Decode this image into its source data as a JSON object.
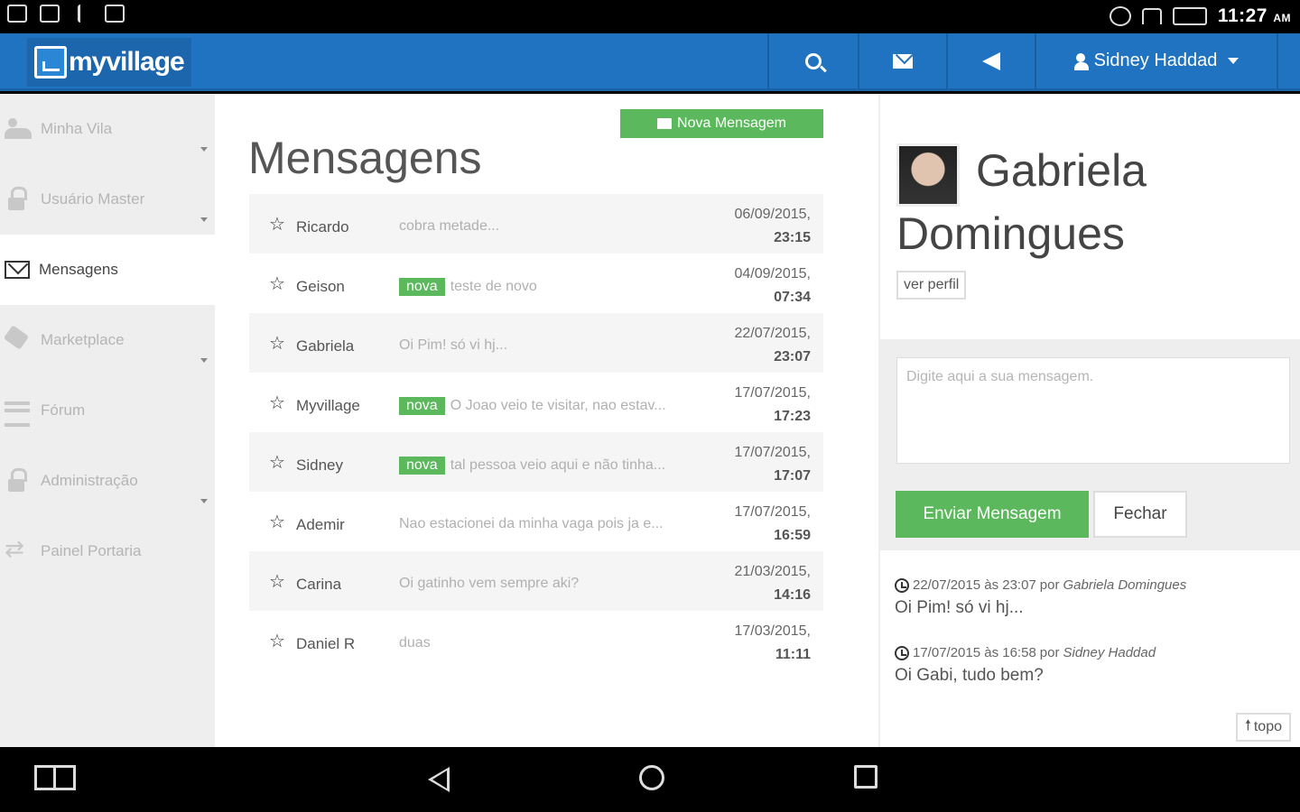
{
  "status_bar": {
    "time": "11:27",
    "ampm": "AM",
    "icons": [
      "gallery-icon",
      "image-icon",
      "usb-icon",
      "briefcase-icon",
      "at-icon",
      "wifi-icon",
      "battery-icon"
    ]
  },
  "header": {
    "logo_text": "myvillage",
    "user_name": "Sidney Haddad",
    "icons": [
      "search-icon",
      "envelope-icon",
      "megaphone-icon",
      "user-icon"
    ],
    "color": "#1f73c1"
  },
  "sidebar": {
    "items": [
      {
        "label": "Minha Vila",
        "icon": "users-icon",
        "active": false,
        "has_submenu": true
      },
      {
        "label": "Usuário Master",
        "icon": "lock-icon",
        "active": false,
        "has_submenu": true
      },
      {
        "label": "Mensagens",
        "icon": "envelope-icon",
        "active": true,
        "has_submenu": false
      },
      {
        "label": "Marketplace",
        "icon": "tag-icon",
        "active": false,
        "has_submenu": true
      },
      {
        "label": "Fórum",
        "icon": "forum-icon",
        "active": false,
        "has_submenu": false
      },
      {
        "label": "Administração",
        "icon": "lock-icon",
        "active": false,
        "has_submenu": true
      },
      {
        "label": "Painel Portaria",
        "icon": "swap-icon",
        "active": false,
        "has_submenu": false
      }
    ]
  },
  "messages": {
    "title": "Mensagens",
    "new_button": "Nova Mensagem",
    "badge_label": "nova",
    "items": [
      {
        "sender": "Ricardo",
        "preview": "cobra metade...",
        "is_new": false,
        "date": "06/09/2015,",
        "time": "23:15"
      },
      {
        "sender": "Geison",
        "preview": "teste de novo",
        "is_new": true,
        "date": "04/09/2015,",
        "time": "07:34"
      },
      {
        "sender": "Gabriela",
        "preview": "Oi Pim! só vi hj...",
        "is_new": false,
        "date": "22/07/2015,",
        "time": "23:07"
      },
      {
        "sender": "Myvillage",
        "preview": "O Joao veio te visitar, nao estav...",
        "is_new": true,
        "date": "17/07/2015,",
        "time": "17:23"
      },
      {
        "sender": "Sidney",
        "preview": "tal pessoa veio aqui e não tinha...",
        "is_new": true,
        "date": "17/07/2015,",
        "time": "17:07"
      },
      {
        "sender": "Ademir",
        "preview": "Nao estacionei da minha vaga pois ja e...",
        "is_new": false,
        "date": "17/07/2015,",
        "time": "16:59"
      },
      {
        "sender": "Carina",
        "preview": "Oi gatinho vem sempre aki?",
        "is_new": false,
        "date": "21/03/2015,",
        "time": "14:16"
      },
      {
        "sender": "Daniel R",
        "preview": "duas",
        "is_new": false,
        "date": "17/03/2015,",
        "time": "11:11"
      }
    ]
  },
  "conversation": {
    "contact_name": "Gabriela Domingues",
    "profile_button": "ver perfil",
    "input_placeholder": "Digite aqui a sua mensagem.",
    "send_button": "Enviar Mensagem",
    "close_button": "Fechar",
    "history": [
      {
        "timestamp": "22/07/2015 às 23:07",
        "by_label": "por",
        "author": "Gabriela Domingues",
        "text": "Oi Pim! só vi hj..."
      },
      {
        "timestamp": "17/07/2015 às 16:58",
        "by_label": "por",
        "author": "Sidney Haddad",
        "text": "Oi Gabi, tudo bem?"
      }
    ],
    "top_button": "topo"
  },
  "colors": {
    "primary": "#1f73c1",
    "success": "#5cb85c",
    "sidebar_bg": "#eeeeee"
  }
}
